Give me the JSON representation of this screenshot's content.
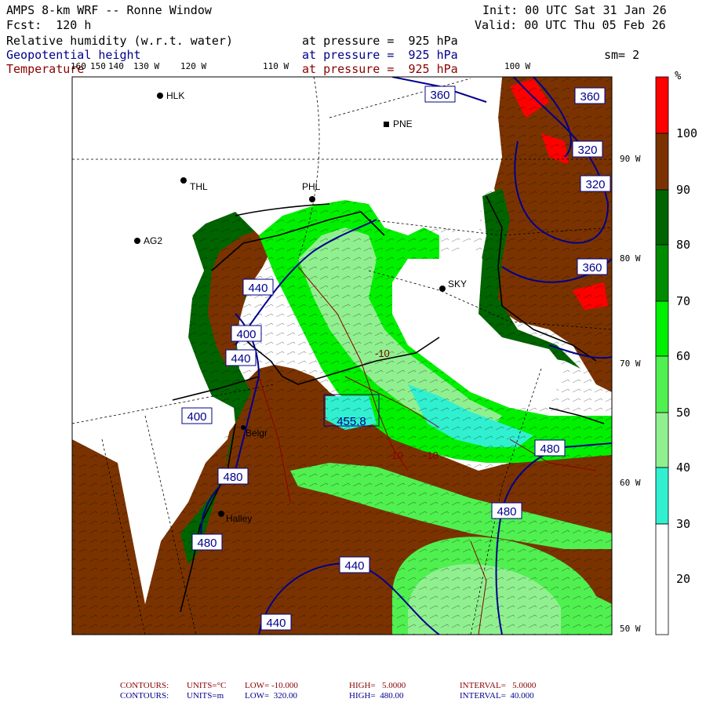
{
  "header": {
    "title": "AMPS 8-km WRF -- Ronne Window",
    "fcst": "Fcst:  120 h",
    "init": "Init: 00 UTC Sat 31 Jan 26",
    "valid": "Valid: 00 UTC Thu 05 Feb 26",
    "smooth": "sm= 2"
  },
  "fields": [
    {
      "name": "Relative humidity (w.r.t. water)",
      "level": "at pressure =  925 hPa",
      "color": "#000000"
    },
    {
      "name": "Geopotential height",
      "level": "at pressure =  925 hPa",
      "color": "#00008b"
    },
    {
      "name": "Temperature",
      "level": "at pressure =  925 hPa",
      "color": "#8b0000"
    }
  ],
  "longitude_labels": [
    "160",
    "150",
    "140",
    "130 W",
    "120 W",
    "110 W",
    "100 W"
  ],
  "latitude_labels": [
    "90 W",
    "80 W",
    "70 W",
    "60 W",
    "50 W"
  ],
  "stations": [
    "HLK",
    "PNE",
    "THL",
    "PHL",
    "AG2",
    "SKY",
    "Halley",
    "Belgr"
  ],
  "height_contour_labels": [
    "360",
    "360",
    "320",
    "320",
    "360",
    "440",
    "400",
    "440",
    "400",
    "480",
    "455.8",
    "480",
    "480",
    "480",
    "440",
    "440"
  ],
  "temperature_contour_labels": [
    "-10",
    "-10",
    "-10"
  ],
  "colorbar": {
    "unit": "%",
    "ticks": [
      "100",
      "90",
      "80",
      "70",
      "60",
      "50",
      "40",
      "30",
      "20"
    ],
    "colors": [
      "#ff0000",
      "#7a3300",
      "#006400",
      "#008c00",
      "#00f000",
      "#50f050",
      "#90f090",
      "#30f0d0",
      "#ffffff"
    ]
  },
  "footer": {
    "temperature": {
      "label": "CONTOURS:",
      "units": "UNITS=°C",
      "low": "LOW= -10.000",
      "high": "HIGH=   5.0000",
      "interval": "INTERVAL=   5.0000",
      "color": "#8b0000"
    },
    "height": {
      "label": "CONTOURS:",
      "units": "UNITS=m",
      "low": "LOW=  320.00",
      "high": "HIGH=  480.00",
      "interval": "INTERVAL=  40.000",
      "color": "#00008b"
    }
  },
  "map_colors": {
    "brown": "#7a3300",
    "green_dark": "#006400",
    "green": "#00f000",
    "green_light": "#50f050",
    "green_pale": "#90f090",
    "cyan": "#30f0d0",
    "height_line": "#00008b",
    "temp_line": "#8b0000"
  }
}
